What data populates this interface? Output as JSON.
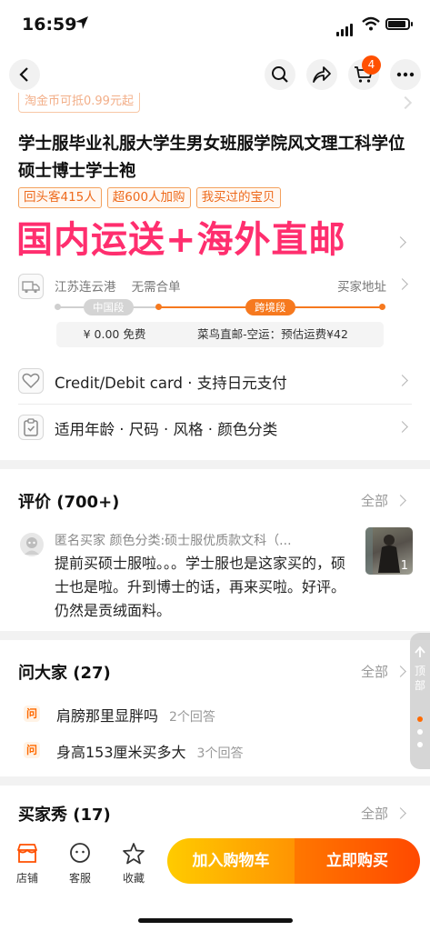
{
  "status": {
    "time": "16:59"
  },
  "nav": {
    "cart_badge": "4"
  },
  "product": {
    "coupon_strip": "淘金币可抵0.99元起",
    "title": "学士服毕业礼服大学生男女班服学院风文理工科学位硕士博士学士袍",
    "tags": [
      "回头客415人",
      "超600人加购",
      "我买过的宝贝"
    ],
    "promo_banner": "国内运送+海外直邮"
  },
  "shipping": {
    "from": "江苏连云港",
    "merge_note": "无需合单",
    "to": "买家地址",
    "domestic_label": "中国段",
    "intl_label": "跨境段",
    "domestic_fee": "¥ 0.00 免费",
    "intl_fee": "菜鸟直邮-空运：预估运费¥42"
  },
  "payment": {
    "text": "Credit/Debit card · 支持日元支付"
  },
  "spec": {
    "text": "适用年龄 · 尺码 · 风格 · 颜色分类"
  },
  "reviews": {
    "title": "评价 (700+)",
    "all_label": "全部",
    "user": "匿名买家  颜色分类:硕士服优质款文科（...",
    "text": "提前买硕士服啦。。。学士服也是这家买的，硕士也是啦。升到博士的话，再来买啦。好评。仍然是贡绒面料。",
    "image_count": "1"
  },
  "qa": {
    "title": "问大家 (27)",
    "all_label": "全部",
    "icon_label": "问",
    "items": [
      {
        "question": "肩膀那里显胖吗",
        "answers": "2个回答"
      },
      {
        "question": "身高153厘米买多大",
        "answers": "3个回答"
      }
    ]
  },
  "buyer_show": {
    "title": "买家秀 (17)",
    "all_label": "全部"
  },
  "float_btn": {
    "label": "顶部"
  },
  "bottom_bar": {
    "store": "店铺",
    "service": "客服",
    "favorite": "收藏",
    "add_to_cart": "加入购物车",
    "buy_now": "立即购买"
  },
  "colors": {
    "accent": "#ff5000",
    "banner": "#ff2e6e",
    "cart_btn": "#ffb400",
    "buy_btn": "#ff5a00"
  }
}
